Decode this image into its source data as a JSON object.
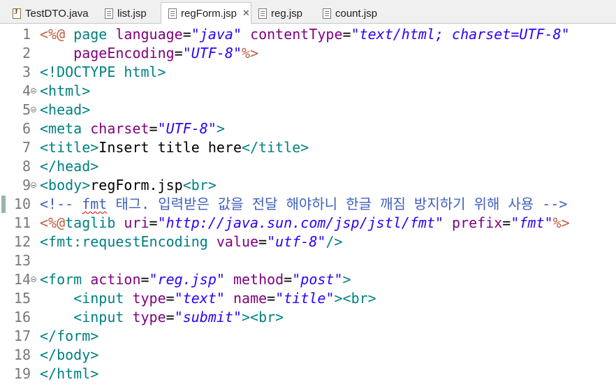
{
  "tabs": [
    {
      "label": "TestDTO.java",
      "icon": "java-file-icon",
      "active": false
    },
    {
      "label": "list.jsp",
      "icon": "jsp-file-icon",
      "active": false
    },
    {
      "label": "regForm.jsp",
      "icon": "jsp-file-icon",
      "active": true,
      "close": "✕"
    },
    {
      "label": "reg.jsp",
      "icon": "jsp-file-icon",
      "active": false
    },
    {
      "label": "count.jsp",
      "icon": "jsp-file-icon",
      "active": false
    }
  ],
  "editor": {
    "lines": [
      {
        "num": "1",
        "fold": false,
        "tokens": [
          [
            "dl",
            "<%@ "
          ],
          [
            "tg",
            "page "
          ],
          [
            "at",
            "language"
          ],
          [
            "txt",
            "="
          ],
          [
            "val",
            "\"java\""
          ],
          [
            "txt",
            " "
          ],
          [
            "at",
            "contentType"
          ],
          [
            "txt",
            "="
          ],
          [
            "val",
            "\"text/html; charset=UTF-8\""
          ]
        ]
      },
      {
        "num": "2",
        "fold": false,
        "tokens": [
          [
            "txt",
            "    "
          ],
          [
            "at",
            "pageEncoding"
          ],
          [
            "txt",
            "="
          ],
          [
            "val",
            "\"UTF-8\""
          ],
          [
            "dl",
            "%>"
          ]
        ]
      },
      {
        "num": "3",
        "fold": false,
        "tokens": [
          [
            "tg",
            "<!DOCTYPE "
          ],
          [
            "tg",
            "html"
          ],
          [
            "tg",
            ">"
          ]
        ]
      },
      {
        "num": "4",
        "fold": true,
        "tokens": [
          [
            "tg",
            "<html>"
          ]
        ]
      },
      {
        "num": "5",
        "fold": true,
        "tokens": [
          [
            "tg",
            "<head>"
          ]
        ]
      },
      {
        "num": "6",
        "fold": false,
        "tokens": [
          [
            "tg",
            "<meta "
          ],
          [
            "at",
            "charset"
          ],
          [
            "txt",
            "="
          ],
          [
            "val",
            "\"UTF-8\""
          ],
          [
            "tg",
            ">"
          ]
        ]
      },
      {
        "num": "7",
        "fold": false,
        "tokens": [
          [
            "tg",
            "<title>"
          ],
          [
            "txt",
            "Insert title here"
          ],
          [
            "tg",
            "</title>"
          ]
        ]
      },
      {
        "num": "8",
        "fold": false,
        "tokens": [
          [
            "tg",
            "</head>"
          ]
        ]
      },
      {
        "num": "9",
        "fold": true,
        "tokens": [
          [
            "tg",
            "<body>"
          ],
          [
            "txt",
            "regForm.jsp"
          ],
          [
            "tg",
            "<br>"
          ]
        ]
      },
      {
        "num": "10",
        "fold": false,
        "selected": true,
        "tokens": [
          [
            "cm",
            "<!-- "
          ],
          [
            "cm-sq",
            "fmt"
          ],
          [
            "cm",
            " 태그. 입력받은 값을 전달 해야하니 한글 깨짐 방지하기 위해 사용 -->"
          ]
        ]
      },
      {
        "num": "11",
        "fold": false,
        "tokens": [
          [
            "dl",
            "<%@"
          ],
          [
            "tg",
            "taglib "
          ],
          [
            "at",
            "uri"
          ],
          [
            "txt",
            "="
          ],
          [
            "val",
            "\"http://java.sun.com/jsp/jstl/fmt\""
          ],
          [
            "txt",
            " "
          ],
          [
            "at",
            "prefix"
          ],
          [
            "txt",
            "="
          ],
          [
            "val",
            "\"fmt\""
          ],
          [
            "dl",
            "%>"
          ]
        ]
      },
      {
        "num": "12",
        "fold": false,
        "tokens": [
          [
            "tg",
            "<fmt:requestEncoding "
          ],
          [
            "at",
            "value"
          ],
          [
            "txt",
            "="
          ],
          [
            "val",
            "\"utf-8\""
          ],
          [
            "tg",
            "/>"
          ]
        ]
      },
      {
        "num": "13",
        "fold": false,
        "tokens": []
      },
      {
        "num": "14",
        "fold": true,
        "tokens": [
          [
            "tg",
            "<form "
          ],
          [
            "at",
            "action"
          ],
          [
            "txt",
            "="
          ],
          [
            "val",
            "\"reg.jsp\""
          ],
          [
            "txt",
            " "
          ],
          [
            "at",
            "method"
          ],
          [
            "txt",
            "="
          ],
          [
            "val",
            "\"post\""
          ],
          [
            "tg",
            ">"
          ]
        ]
      },
      {
        "num": "15",
        "fold": false,
        "tokens": [
          [
            "txt",
            "    "
          ],
          [
            "tg",
            "<input "
          ],
          [
            "at",
            "type"
          ],
          [
            "txt",
            "="
          ],
          [
            "val",
            "\"text\""
          ],
          [
            "txt",
            " "
          ],
          [
            "at",
            "name"
          ],
          [
            "txt",
            "="
          ],
          [
            "val",
            "\"title\""
          ],
          [
            "tg",
            "><br>"
          ]
        ]
      },
      {
        "num": "16",
        "fold": false,
        "tokens": [
          [
            "txt",
            "    "
          ],
          [
            "tg",
            "<input "
          ],
          [
            "at",
            "type"
          ],
          [
            "txt",
            "="
          ],
          [
            "val",
            "\"submit\""
          ],
          [
            "tg",
            "><br>"
          ]
        ]
      },
      {
        "num": "17",
        "fold": false,
        "tokens": [
          [
            "tg",
            "</form>"
          ]
        ]
      },
      {
        "num": "18",
        "fold": false,
        "tokens": [
          [
            "tg",
            "</body>"
          ]
        ]
      },
      {
        "num": "19",
        "fold": false,
        "tokens": [
          [
            "tg",
            "</html>"
          ]
        ]
      }
    ]
  },
  "colors": {
    "tag": "#008080",
    "attribute": "#7f007f",
    "value": "#2a00ff",
    "directive": "#bf5f3f",
    "comment": "#3f5fbf",
    "line_number": "#787878"
  }
}
